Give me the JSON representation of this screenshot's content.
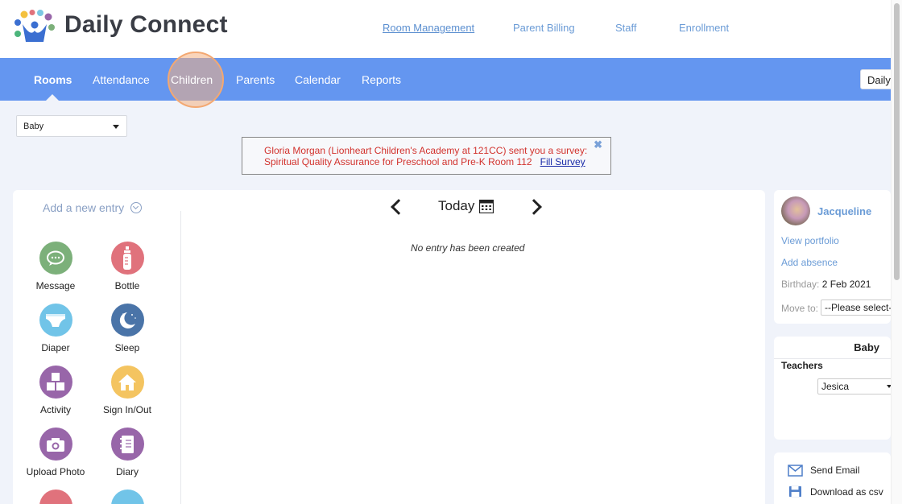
{
  "header": {
    "brand": "Daily Connect",
    "links": [
      "Room Management",
      "Parent Billing",
      "Staff",
      "Enrollment"
    ]
  },
  "nav": {
    "items": [
      "Rooms",
      "Attendance",
      "Children",
      "Parents",
      "Calendar",
      "Reports"
    ],
    "active": "Rooms",
    "right_select": "Daily"
  },
  "room_select": {
    "value": "Baby"
  },
  "survey": {
    "line1": "Gloria Morgan (Lionheart Children's Academy at 121CC) sent you a survey:",
    "line2": "Spiritual Quality Assurance for Preschool and Pre-K Room 112",
    "link": "Fill Survey",
    "close": "✖"
  },
  "entries": {
    "add_label": "Add a new entry",
    "items": [
      {
        "label": "Message",
        "icon": "message-icon",
        "color": "#7cb07a"
      },
      {
        "label": "Bottle",
        "icon": "bottle-icon",
        "color": "#e0727c"
      },
      {
        "label": "Diaper",
        "icon": "diaper-icon",
        "color": "#71c4e8"
      },
      {
        "label": "Sleep",
        "icon": "sleep-icon",
        "color": "#4a74a8"
      },
      {
        "label": "Activity",
        "icon": "blocks-icon",
        "color": "#9866a9"
      },
      {
        "label": "Sign In/Out",
        "icon": "house-icon",
        "color": "#f4c460"
      },
      {
        "label": "Upload Photo",
        "icon": "camera-icon",
        "color": "#9866a9"
      },
      {
        "label": "Diary",
        "icon": "diary-icon",
        "color": "#9866a9"
      }
    ]
  },
  "day": {
    "label": "Today",
    "empty": "No entry has been created"
  },
  "child": {
    "name": "Jacqueline",
    "view_portfolio": "View portfolio",
    "add_absence": "Add absence",
    "birthday_label": "Birthday:",
    "birthday": "2 Feb 2021",
    "move_label": "Move to:",
    "move_value": "--Please select--"
  },
  "room_card": {
    "title": "Baby",
    "teachers_label": "Teachers",
    "teacher": "Jesica"
  },
  "actions": {
    "send_email": "Send Email",
    "download_csv": "Download as csv"
  },
  "colors": {
    "nav": "#6496f0",
    "link": "#6a9bd6",
    "survey_text": "#d2322d",
    "highlight": "#f3a872"
  }
}
